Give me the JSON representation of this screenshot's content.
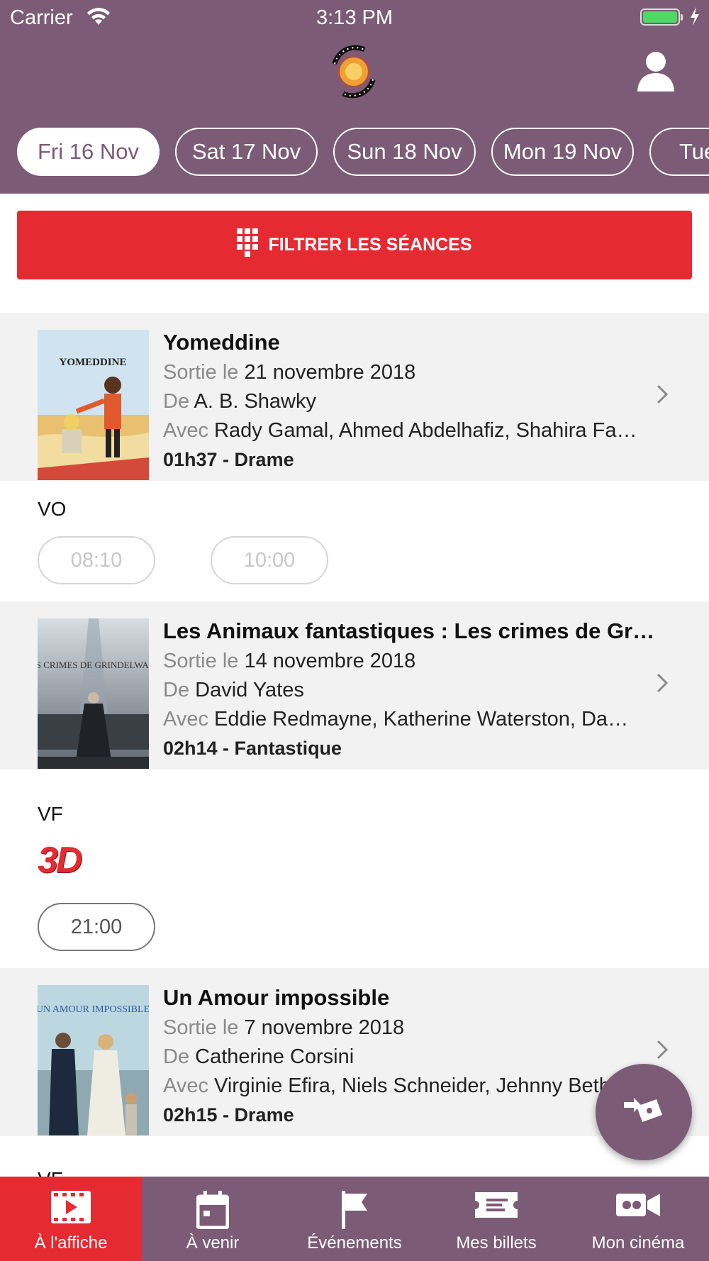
{
  "status_bar": {
    "carrier": "Carrier",
    "time": "3:13 PM"
  },
  "dates": [
    {
      "label": "Fri 16 Nov",
      "active": true
    },
    {
      "label": "Sat 17 Nov",
      "active": false
    },
    {
      "label": "Sun 18 Nov",
      "active": false
    },
    {
      "label": "Mon 19 Nov",
      "active": false
    },
    {
      "label": "Tue",
      "active": false
    }
  ],
  "filter": {
    "label": "FILTRER LES SÉANCES"
  },
  "labels": {
    "release": "Sortie le",
    "director": "De",
    "cast": "Avec"
  },
  "movies": [
    {
      "title": "Yomeddine",
      "poster_text": "YOMEDDINE",
      "release": "21 novembre 2018",
      "director": "A. B. Shawky",
      "cast": "Rady Gamal,  Ahmed Abdelhafiz,  Shahira Fahmy",
      "duration_genre": "01h37 - Drame",
      "version": "VO",
      "times": [
        {
          "time": "08:10",
          "available": false
        },
        {
          "time": "10:00",
          "available": false
        }
      ]
    },
    {
      "title": "Les Animaux fantastiques : Les crimes de Grindelwald",
      "poster_text": "LES CRIMES DE GRINDELWALD",
      "release": "14 novembre 2018",
      "director": "David Yates",
      "cast": "Eddie Redmayne,  Katherine Waterston,  Dan Fogler",
      "duration_genre": "02h14 - Fantastique",
      "version": "VF",
      "format_badge": "3D",
      "times": [
        {
          "time": "21:00",
          "available": true
        }
      ]
    },
    {
      "title": "Un Amour impossible",
      "poster_text": "UN AMOUR IMPOSSIBLE",
      "release": "7 novembre 2018",
      "director": "Catherine Corsini",
      "cast": "Virginie Efira,  Niels Schneider,  Jehnny Beth",
      "duration_genre": "02h15 - Drame",
      "version": "VF"
    }
  ],
  "tabs": [
    {
      "label": "À l'affiche",
      "icon": "film-icon",
      "active": true
    },
    {
      "label": "À venir",
      "icon": "calendar-icon",
      "active": false
    },
    {
      "label": "Événements",
      "icon": "flag-icon",
      "active": false
    },
    {
      "label": "Mes billets",
      "icon": "ticket-icon",
      "active": false
    },
    {
      "label": "Mon cinéma",
      "icon": "video-camera-icon",
      "active": false
    }
  ],
  "colors": {
    "header": "#7c5b76",
    "accent": "#e52a32",
    "card": "#f2f2f2"
  }
}
